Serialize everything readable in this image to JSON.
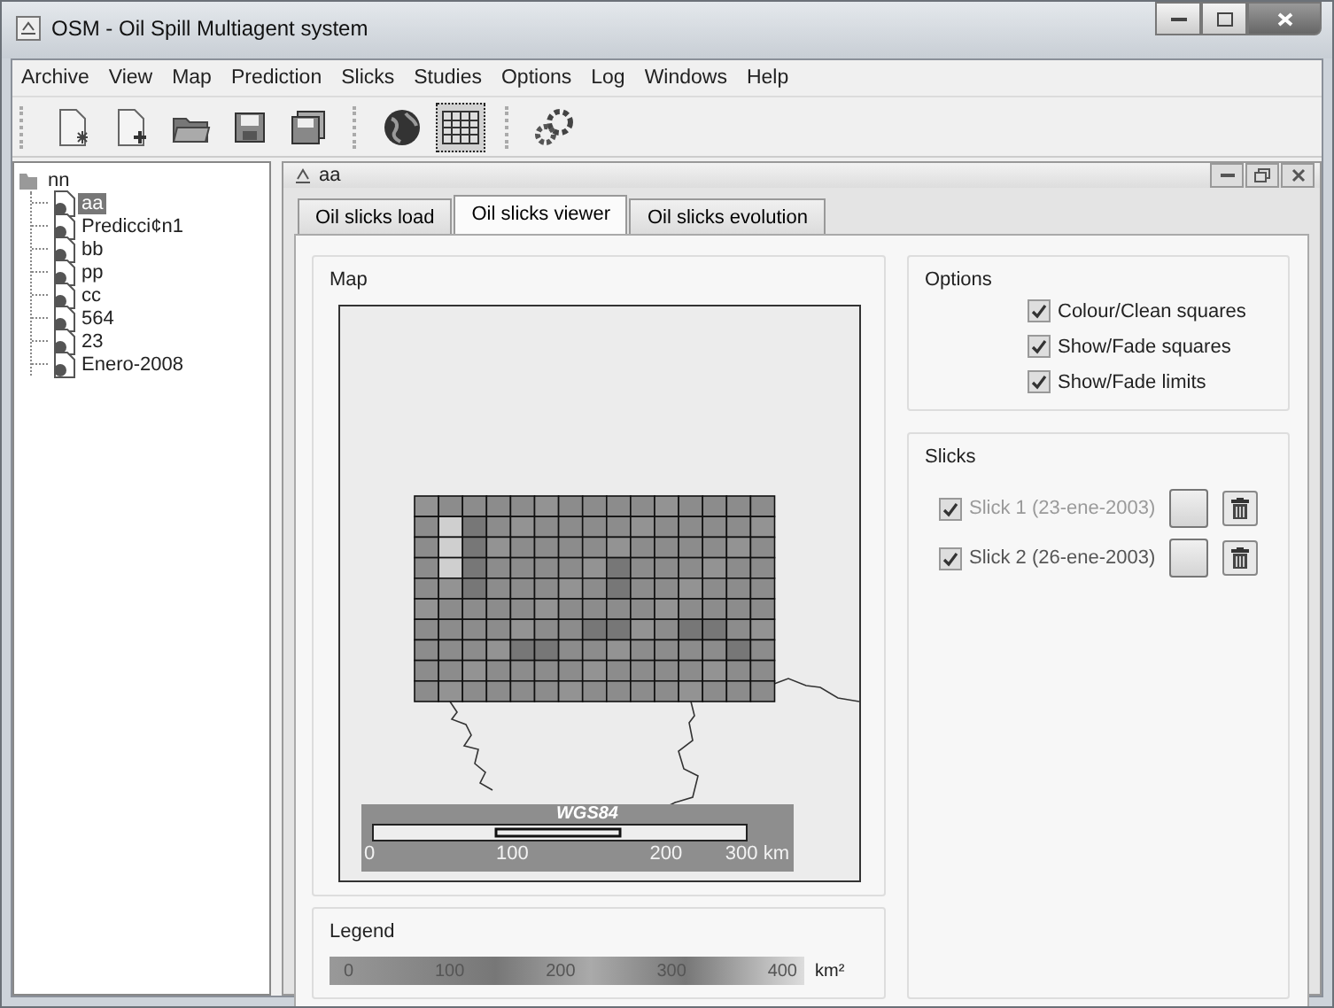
{
  "window": {
    "title": "OSM - Oil Spill Multiagent system"
  },
  "menu": [
    "Archive",
    "View",
    "Map",
    "Prediction",
    "Slicks",
    "Studies",
    "Options",
    "Log",
    "Windows",
    "Help"
  ],
  "toolbar": [
    {
      "kind": "new-star",
      "pressed": false
    },
    {
      "kind": "new-plus",
      "pressed": false
    },
    {
      "kind": "open",
      "pressed": false
    },
    {
      "kind": "save",
      "pressed": false
    },
    {
      "kind": "save-all",
      "pressed": false
    },
    {
      "kind": "separator"
    },
    {
      "kind": "globe",
      "pressed": false
    },
    {
      "kind": "grid",
      "pressed": true
    },
    {
      "kind": "separator"
    },
    {
      "kind": "gears",
      "pressed": false
    }
  ],
  "tree": {
    "label": "nn",
    "children": [
      {
        "label": "aa",
        "selected": true
      },
      {
        "label": "Predicci¢n1",
        "selected": false
      },
      {
        "label": "bb",
        "selected": false
      },
      {
        "label": "pp",
        "selected": false
      },
      {
        "label": "cc",
        "selected": false
      },
      {
        "label": "564",
        "selected": false
      },
      {
        "label": "23",
        "selected": false
      },
      {
        "label": "Enero-2008",
        "selected": false
      }
    ]
  },
  "frame": {
    "title": "aa",
    "tabs": [
      {
        "label": "Oil slicks load",
        "selected": false
      },
      {
        "label": "Oil slicks viewer",
        "selected": true
      },
      {
        "label": "Oil slicks evolution",
        "selected": false
      }
    ],
    "map": {
      "title": "Map",
      "scale": {
        "datum": "WGS84",
        "labels": [
          "0",
          "100",
          "200",
          "300 km"
        ]
      }
    },
    "legend": {
      "title": "Legend",
      "labels": [
        "0",
        "100",
        "200",
        "300",
        "400"
      ],
      "unit": "km²"
    },
    "options": {
      "title": "Options",
      "items": [
        {
          "label": "Colour/Clean squares",
          "checked": true
        },
        {
          "label": "Show/Fade squares",
          "checked": true
        },
        {
          "label": "Show/Fade limits",
          "checked": true
        }
      ]
    },
    "slicks": {
      "title": "Slicks",
      "items": [
        {
          "label": "Slick 1 (23-ene-2003)",
          "checked": true,
          "disabled": true
        },
        {
          "label": "Slick 2 (26-ene-2003)",
          "checked": true,
          "disabled": false
        }
      ]
    }
  }
}
